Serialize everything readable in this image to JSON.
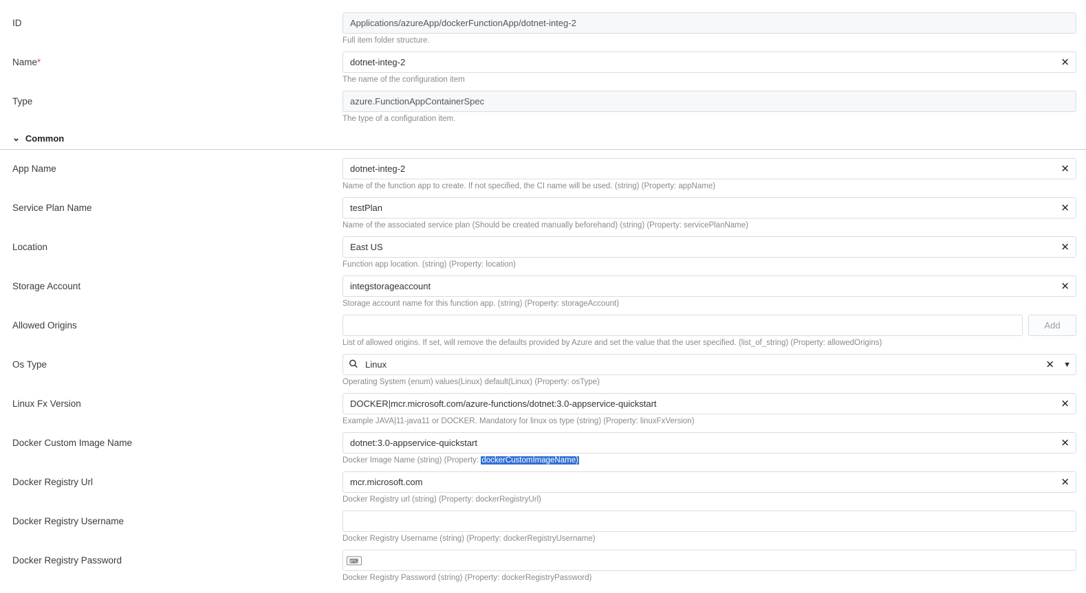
{
  "fields": {
    "id": {
      "label": "ID",
      "value": "Applications/azureApp/dockerFunctionApp/dotnet-integ-2",
      "help": "Full item folder structure."
    },
    "name": {
      "label": "Name",
      "value": "dotnet-integ-2",
      "help": "The name of the configuration item"
    },
    "type": {
      "label": "Type",
      "value": "azure.FunctionAppContainerSpec",
      "help": "The type of a configuration item."
    },
    "appName": {
      "label": "App Name",
      "value": "dotnet-integ-2",
      "help": "Name of the function app to create. If not specified, the CI name will be used. (string) (Property: appName)"
    },
    "servicePlan": {
      "label": "Service Plan Name",
      "value": "testPlan",
      "help": "Name of the associated service plan (Should be created manually beforehand) (string) (Property: servicePlanName)"
    },
    "location": {
      "label": "Location",
      "value": "East US",
      "help": "Function app location. (string) (Property: location)"
    },
    "storage": {
      "label": "Storage Account",
      "value": "integstorageaccount",
      "help": "Storage account name for this function app. (string) (Property: storageAccount)"
    },
    "allowedOrigins": {
      "label": "Allowed Origins",
      "help": "List of allowed origins. If set, will remove the defaults provided by Azure and set the value that the user specified. (list_of_string) (Property: allowedOrigins)",
      "addLabel": "Add"
    },
    "osType": {
      "label": "Os Type",
      "value": "Linux",
      "help": "Operating System (enum) values(Linux) default(Linux) (Property: osType)"
    },
    "linuxFx": {
      "label": "Linux Fx Version",
      "value": "DOCKER|mcr.microsoft.com/azure-functions/dotnet:3.0-appservice-quickstart",
      "help": "Example JAVA|11-java11 or DOCKER. Mandatory for linux os type (string) (Property: linuxFxVersion)"
    },
    "dockerImage": {
      "label": "Docker Custom Image Name",
      "value": "dotnet:3.0-appservice-quickstart",
      "helpPrefix": "Docker Image Name (string) (Property: ",
      "helpHighlight": "dockerCustomImageName)"
    },
    "registryUrl": {
      "label": "Docker Registry Url",
      "value": "mcr.microsoft.com",
      "help": "Docker Registry url (string) (Property: dockerRegistryUrl)"
    },
    "registryUser": {
      "label": "Docker Registry Username",
      "value": "",
      "help": "Docker Registry Username (string) (Property: dockerRegistryUsername)"
    },
    "registryPw": {
      "label": "Docker Registry Password",
      "value": "",
      "help": "Docker Registry Password (string) (Property: dockerRegistryPassword)"
    }
  },
  "section": {
    "common": "Common"
  }
}
